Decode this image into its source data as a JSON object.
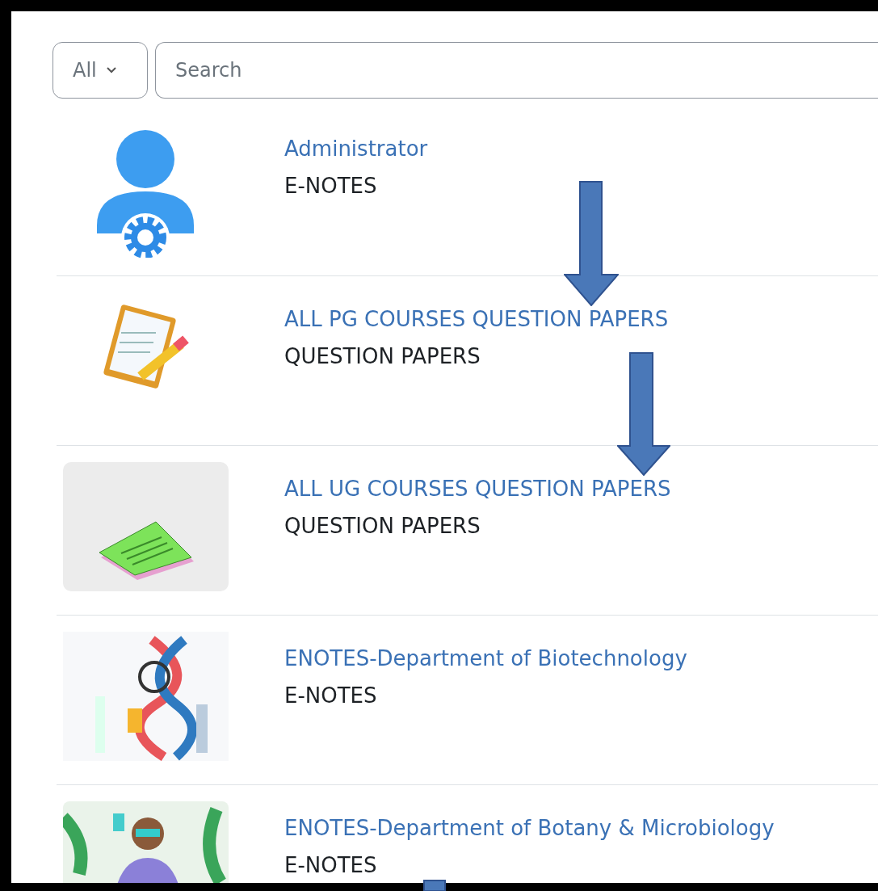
{
  "filter": {
    "label": "All"
  },
  "search": {
    "placeholder": "Search"
  },
  "courses": [
    {
      "title": "Administrator",
      "category": "E-NOTES",
      "kind": "admin"
    },
    {
      "title": "ALL PG COURSES QUESTION PAPERS",
      "category": "QUESTION PAPERS",
      "kind": "clipboard"
    },
    {
      "title": "ALL UG COURSES QUESTION PAPERS",
      "category": "QUESTION PAPERS",
      "kind": "papers"
    },
    {
      "title": "ENOTES-Department of Biotechnology",
      "category": "E-NOTES",
      "kind": "dna"
    },
    {
      "title": "ENOTES-Department of Botany & Microbiology",
      "category": "E-NOTES",
      "kind": "scientist"
    }
  ]
}
